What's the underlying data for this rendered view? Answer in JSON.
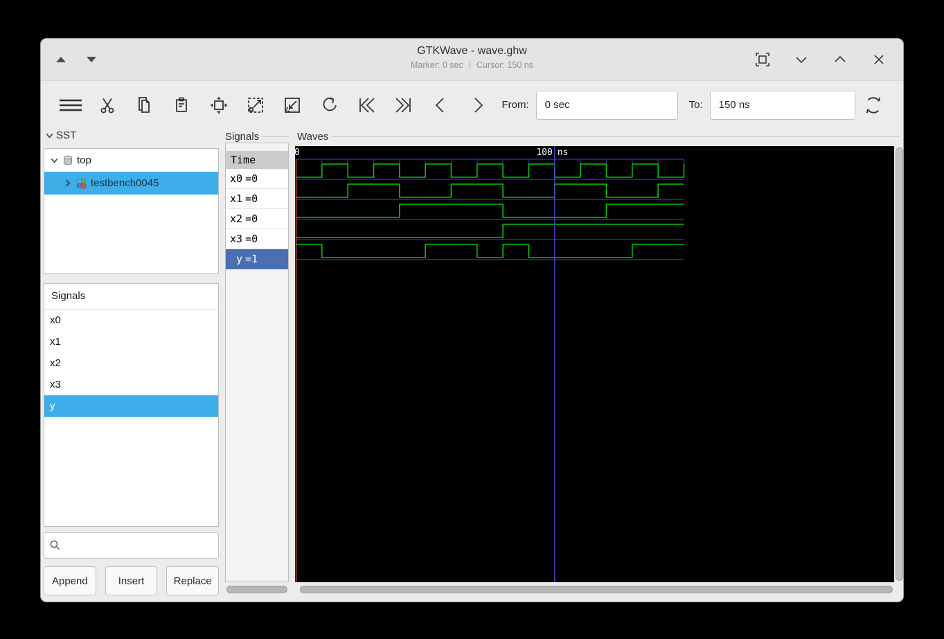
{
  "window": {
    "title": "GTKWave - wave.ghw",
    "marker_status": "Marker: 0 sec",
    "status_separator": "|",
    "cursor_status": "Cursor: 150 ns"
  },
  "toolbar": {
    "from_label": "From:",
    "from_value": "0 sec",
    "to_label": "To:",
    "to_value": "150 ns"
  },
  "sst": {
    "header": "SST",
    "tree": {
      "root_label": "top",
      "child_label": "testbench0045",
      "child_selected": true
    },
    "list_header": "Signals",
    "signals": [
      "x0",
      "x1",
      "x2",
      "x3",
      "y"
    ],
    "selected_signal": "y",
    "search_value": "",
    "buttons": [
      "Append",
      "Insert",
      "Replace"
    ]
  },
  "signals_panel": {
    "frame_label": "Signals",
    "time_header": "Time",
    "rows": [
      {
        "name": "x0",
        "value": "=0",
        "selected": false
      },
      {
        "name": "x1",
        "value": "=0",
        "selected": false
      },
      {
        "name": "x2",
        "value": "=0",
        "selected": false
      },
      {
        "name": "x3",
        "value": "=0",
        "selected": false
      },
      {
        "name": "y",
        "value": "=1",
        "selected": true
      }
    ]
  },
  "waves": {
    "frame_label": "Waves",
    "timeline": {
      "zero_label": "0",
      "major_tick_label": "100",
      "unit_label": "ns",
      "tick_interval_ns": 10,
      "major_at_ns": 100
    },
    "time_start_ns": 0,
    "time_end_ns": 150,
    "marker_ns": 0,
    "signals": [
      {
        "name": "x0",
        "initial": 0,
        "toggle_times_ns": [
          10,
          20,
          30,
          40,
          50,
          60,
          70,
          80,
          90,
          100,
          110,
          120,
          130,
          140,
          150
        ]
      },
      {
        "name": "x1",
        "initial": 0,
        "toggle_times_ns": [
          20,
          40,
          60,
          80,
          100,
          120,
          140
        ]
      },
      {
        "name": "x2",
        "initial": 0,
        "toggle_times_ns": [
          40,
          80,
          120
        ]
      },
      {
        "name": "x3",
        "initial": 0,
        "toggle_times_ns": [
          80
        ]
      },
      {
        "name": "y",
        "initial": 1,
        "toggle_times_ns": [
          10,
          50,
          70,
          80,
          90,
          130
        ]
      }
    ],
    "colors": {
      "background": "#000000",
      "wave": "#00c800",
      "lane_line": "#2a2aa4",
      "major_line": "#4646c8",
      "marker": "#cc4444",
      "text": "#ffffff"
    }
  }
}
